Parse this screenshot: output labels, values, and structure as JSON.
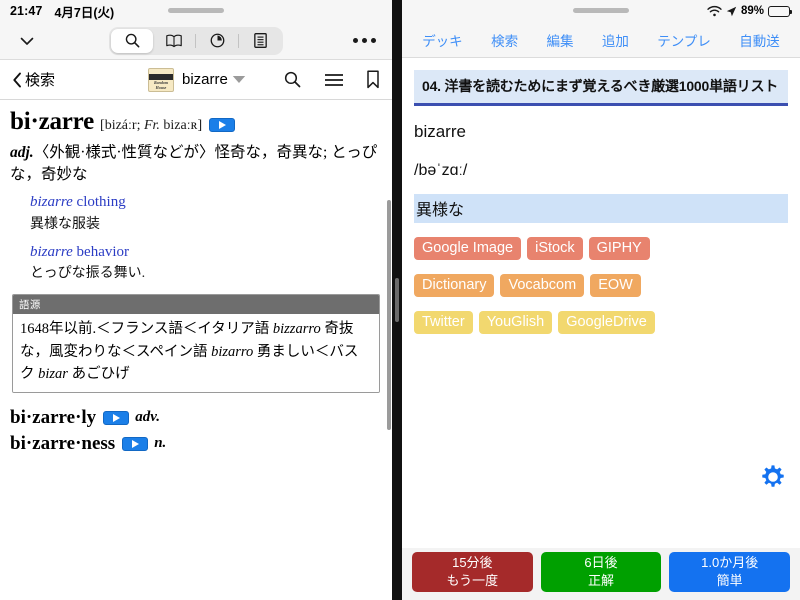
{
  "status_left": {
    "time": "21:47",
    "date": "4月7日(火)"
  },
  "status_right": {
    "battery_percent": "89%",
    "wifi_icon": "wifi-icon",
    "location_icon": "location-arrow-icon",
    "battery_icon": "battery-icon"
  },
  "dict_toolbar": {
    "collapse_icon": "chevron-down-icon",
    "segments": [
      {
        "name": "search-icon",
        "active": true
      },
      {
        "name": "book-icon",
        "active": false
      },
      {
        "name": "clock-icon",
        "active": false
      },
      {
        "name": "list-icon",
        "active": false
      }
    ],
    "more_icon": "more-dots-icon"
  },
  "dict_header": {
    "back_label": "検索",
    "back_icon": "chevron-left-icon",
    "source_badge_line1": "Random",
    "source_badge_line2": "House",
    "word": "bizarre",
    "caret_icon": "caret-down-icon",
    "search_icon": "search-icon",
    "menu_icon": "hamburger-menu-icon",
    "bookmark_icon": "bookmark-icon"
  },
  "entry": {
    "headword": "bi·zarre",
    "phonetic_open": "[",
    "phonetic_en": "bizáːr;",
    "phonetic_fr_label": "Fr.",
    "phonetic_fr": "bizaːʀ",
    "phonetic_close": "]",
    "speaker_icon": "speaker-play-icon",
    "pos": "adj.",
    "definition": "〈外観·様式·性質などが〉怪奇な，奇異な; とっぴな，奇妙な",
    "examples": [
      {
        "term": "bizarre",
        "rest": " clothing",
        "translation": "異様な服装"
      },
      {
        "term": "bizarre",
        "rest": " behavior",
        "translation": "とっぴな振る舞い."
      }
    ],
    "etymology_label": "語源",
    "etymology_text_1": "1648年以前.＜フランス語＜イタリア語 ",
    "etymology_it_1": "bizzarro",
    "etymology_text_2": " 奇抜な，風変わりな＜スペイン語 ",
    "etymology_it_2": "bizarro",
    "etymology_text_3": " 勇ましい＜バスク ",
    "etymology_it_3": "bizar",
    "etymology_text_4": " あごひげ",
    "derived": [
      {
        "word": "bi·zarre·ly",
        "icon": "speaker-play-icon",
        "pos": "adv."
      },
      {
        "word": "bi·zarre·ness",
        "icon": "speaker-play-icon",
        "pos": "n."
      }
    ]
  },
  "anki_nav": [
    {
      "label": "デッキ",
      "name": "tab-decks"
    },
    {
      "label": "検索",
      "name": "tab-search"
    },
    {
      "label": "編集",
      "name": "tab-edit"
    },
    {
      "label": "追加",
      "name": "tab-add"
    },
    {
      "label": "テンプレ",
      "name": "tab-template"
    },
    {
      "label": "自動送",
      "name": "tab-autoplay"
    }
  ],
  "anki_card": {
    "deck_title": "04. 洋書を読むためにまず覚えるべき厳選1000単語リスト",
    "word": "bizarre",
    "ipa": "/bəˈzɑː/",
    "meaning": "異様な",
    "chip_rows": [
      {
        "color": "#e8836e",
        "chips": [
          "Google Image",
          "iStock",
          "GIPHY"
        ]
      },
      {
        "color": "#f0a860",
        "chips": [
          "Dictionary",
          "Vocabcom",
          "EOW"
        ]
      },
      {
        "color": "#f2d86f",
        "chips": [
          "Twitter",
          "YouGlish",
          "GoogleDrive"
        ]
      }
    ],
    "settings_icon": "gear-icon"
  },
  "answer_buttons": [
    {
      "interval": "15分後",
      "label": "もう一度",
      "color": "#a52a2a",
      "name": "answer-again"
    },
    {
      "interval": "6日後",
      "label": "正解",
      "color": "#00a000",
      "name": "answer-good"
    },
    {
      "interval": "1.0か月後",
      "label": "簡単",
      "color": "#1472f0",
      "name": "answer-easy"
    }
  ]
}
